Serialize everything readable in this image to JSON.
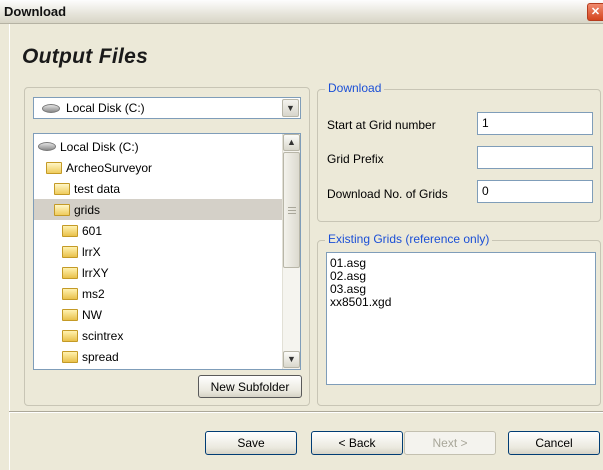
{
  "window": {
    "title": "Download",
    "close_glyph": "✕"
  },
  "heading": "Output Files",
  "drive_select": {
    "value": "Local Disk (C:)"
  },
  "folder_tree": {
    "items": [
      {
        "label": "Local Disk (C:)",
        "icon": "drive-icon",
        "selected": false
      },
      {
        "label": "ArcheoSurveyor",
        "icon": "folder-open-icon",
        "selected": false
      },
      {
        "label": "test data",
        "icon": "folder-open-icon",
        "selected": false
      },
      {
        "label": "grids",
        "icon": "folder-open-icon",
        "selected": true
      },
      {
        "label": "601",
        "icon": "folder-icon",
        "selected": false
      },
      {
        "label": "lrrX",
        "icon": "folder-icon",
        "selected": false
      },
      {
        "label": "lrrXY",
        "icon": "folder-icon",
        "selected": false
      },
      {
        "label": "ms2",
        "icon": "folder-icon",
        "selected": false
      },
      {
        "label": "NW",
        "icon": "folder-icon",
        "selected": false
      },
      {
        "label": "scintrex",
        "icon": "folder-icon",
        "selected": false
      },
      {
        "label": "spread",
        "icon": "folder-icon",
        "selected": false
      }
    ]
  },
  "new_subfolder_label": "New Subfolder",
  "download_group": {
    "legend": "Download",
    "start_grid_label": "Start at Grid number",
    "start_grid_value": "1",
    "grid_prefix_label": "Grid Prefix",
    "grid_prefix_value": "",
    "num_grids_label": "Download No. of Grids",
    "num_grids_value": "0"
  },
  "existing_grids": {
    "legend": "Existing Grids (reference only)",
    "items": [
      "01.asg",
      "02.asg",
      "03.asg",
      "xx8501.xgd"
    ]
  },
  "buttons": {
    "save": "Save",
    "back": "< Back",
    "next": "Next >",
    "cancel": "Cancel"
  },
  "colors": {
    "accent": "#1b4fd6",
    "selection": "#d4d0c8",
    "face": "#ece9d8"
  }
}
